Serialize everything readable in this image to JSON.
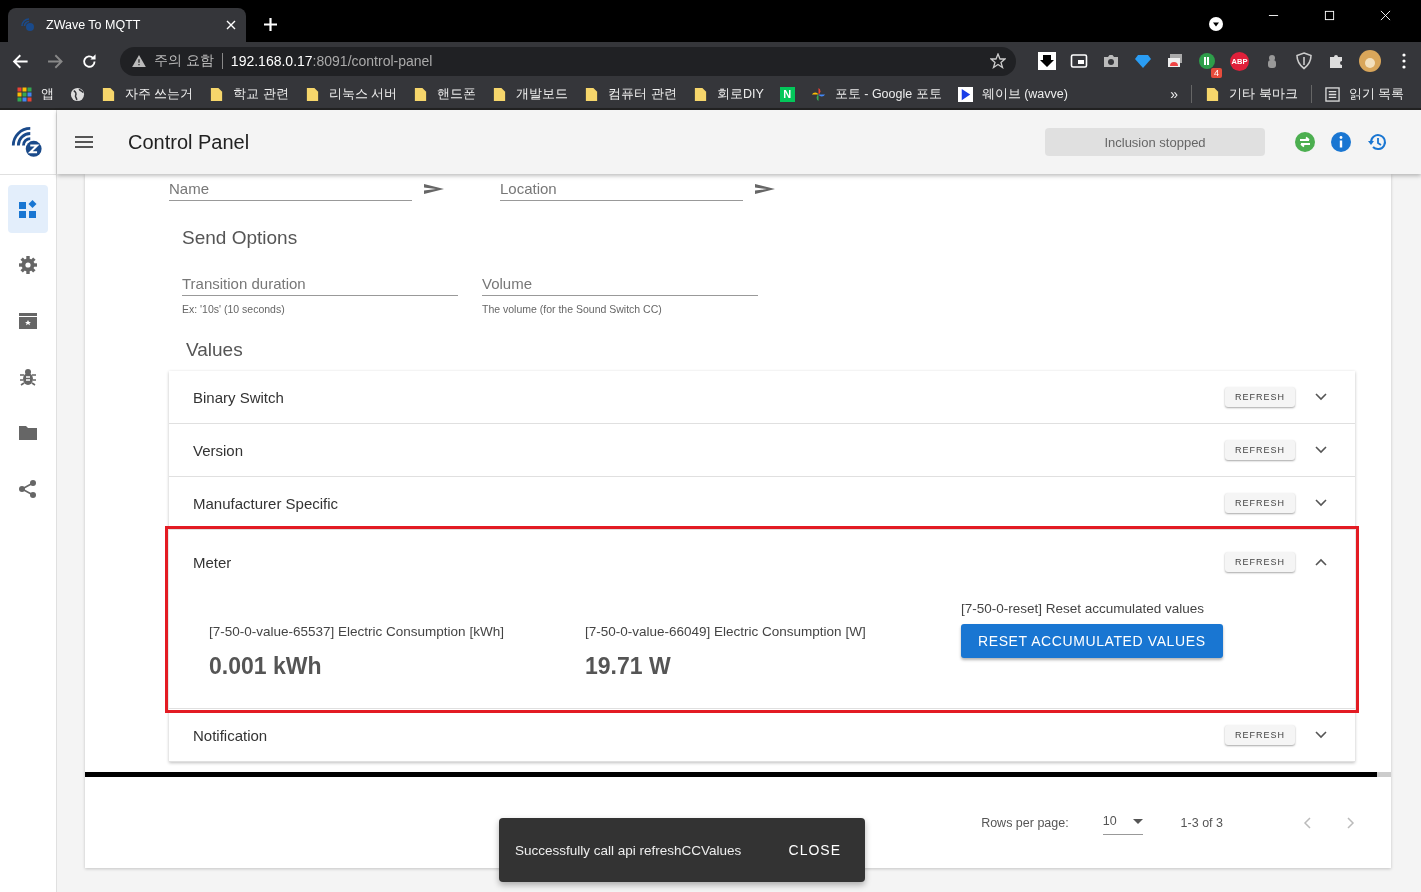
{
  "browser": {
    "tab_title": "ZWave To MQTT",
    "address": {
      "warning": "주의 요함",
      "host": "192.168.0.17",
      "path": ":8091/control-panel"
    },
    "bookmarks": [
      {
        "kind": "apps",
        "label": "앱"
      },
      {
        "kind": "globe"
      },
      {
        "kind": "folder",
        "label": "자주 쓰는거"
      },
      {
        "kind": "folder",
        "label": "학교 관련"
      },
      {
        "kind": "folder",
        "label": "리눅스 서버"
      },
      {
        "kind": "folder",
        "label": "핸드폰"
      },
      {
        "kind": "folder",
        "label": "개발보드"
      },
      {
        "kind": "folder",
        "label": "컴퓨터 관련"
      },
      {
        "kind": "folder",
        "label": "회로DIY"
      },
      {
        "kind": "naver",
        "label": "N"
      },
      {
        "kind": "photos",
        "label": "포토 - Google 포토"
      },
      {
        "kind": "wavve",
        "label": "웨이브 (wavve)"
      }
    ],
    "more": "»",
    "other_bookmarks": "기타 북마크",
    "reading_list": "읽기 목록",
    "extension_badge": "4",
    "adblock_label": "ABP"
  },
  "app": {
    "title": "Control Panel",
    "inclusion_status": "Inclusion stopped",
    "sidebar": [
      {
        "kind": "dashboard",
        "selected": true
      },
      {
        "kind": "settings",
        "selected": false
      },
      {
        "kind": "scenes",
        "selected": false
      },
      {
        "kind": "debug",
        "selected": false
      },
      {
        "kind": "files",
        "selected": false
      },
      {
        "kind": "share",
        "selected": false
      }
    ],
    "name_fields": [
      {
        "placeholder": "Name"
      },
      {
        "placeholder": "Location"
      }
    ],
    "send_options": {
      "title": "Send Options",
      "fields": [
        {
          "placeholder": "Transition duration",
          "hint": "Ex: '10s' (10 seconds)"
        },
        {
          "placeholder": "Volume",
          "hint": "The volume (for the Sound Switch CC)"
        }
      ]
    },
    "values_title": "Values",
    "panels": [
      {
        "name": "Binary Switch",
        "refresh": "REFRESH",
        "expanded": false,
        "highlighted": false
      },
      {
        "name": "Version",
        "refresh": "REFRESH",
        "expanded": false,
        "highlighted": false
      },
      {
        "name": "Manufacturer Specific",
        "refresh": "REFRESH",
        "expanded": false,
        "highlighted": false
      },
      {
        "name": "Meter",
        "refresh": "REFRESH",
        "expanded": true,
        "highlighted": true,
        "values": [
          {
            "kind": "reading",
            "label": "[7-50-0-value-65537] Electric Consumption [kWh]",
            "value": "0.001 kWh"
          },
          {
            "kind": "reading",
            "label": "[7-50-0-value-66049] Electric Consumption [W]",
            "value": "19.71 W"
          },
          {
            "kind": "action",
            "label": "[7-50-0-reset] Reset accumulated values",
            "button": "RESET ACCUMULATED VALUES"
          }
        ]
      },
      {
        "name": "Notification",
        "refresh": "REFRESH",
        "expanded": false,
        "highlighted": false
      }
    ],
    "pagination": {
      "rows_label": "Rows per page:",
      "rows_value": "10",
      "range": "1-3 of 3"
    },
    "snackbar": {
      "message": "Successfully call api refreshCCValues",
      "action": "CLOSE"
    }
  }
}
